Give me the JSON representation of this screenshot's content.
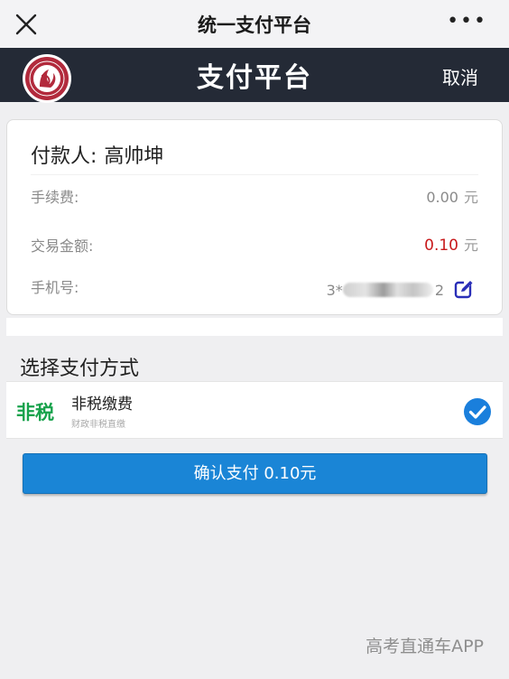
{
  "wechat_bar": {
    "title": "统一支付平台",
    "close_icon": "close-icon",
    "more_icon": "more-dots-icon",
    "more_text": "•••"
  },
  "app_bar": {
    "title": "支付平台",
    "cancel_label": "取消",
    "logo_icon": "university-logo"
  },
  "order": {
    "payer_label": "付款人:",
    "payer_name": "高帅坤",
    "fee_label": "手续费:",
    "fee_value": "0.00",
    "fee_unit": "元",
    "amount_label": "交易金额:",
    "amount_value": "0.10",
    "amount_unit": "元",
    "phone_label": "手机号:",
    "phone_visible_part1": "3*",
    "phone_visible_part2": "2",
    "edit_icon": "edit-icon"
  },
  "payment": {
    "section_title": "选择支付方式",
    "method_badge": "非税",
    "method_name": "非税缴费",
    "method_sub": "财政非税直缴",
    "selected": true,
    "check_icon": "checkmark-icon"
  },
  "confirm_button": {
    "label": "确认支付 0.10元"
  },
  "watermark": "高考直通车APP",
  "colors": {
    "app_bar_bg": "#242a36",
    "confirm_bg": "#1a85d6",
    "amount_red": "#c8191b",
    "badge_green": "#17a24b",
    "check_blue": "#1a7fdc",
    "edit_blue": "#2a2fb8"
  }
}
